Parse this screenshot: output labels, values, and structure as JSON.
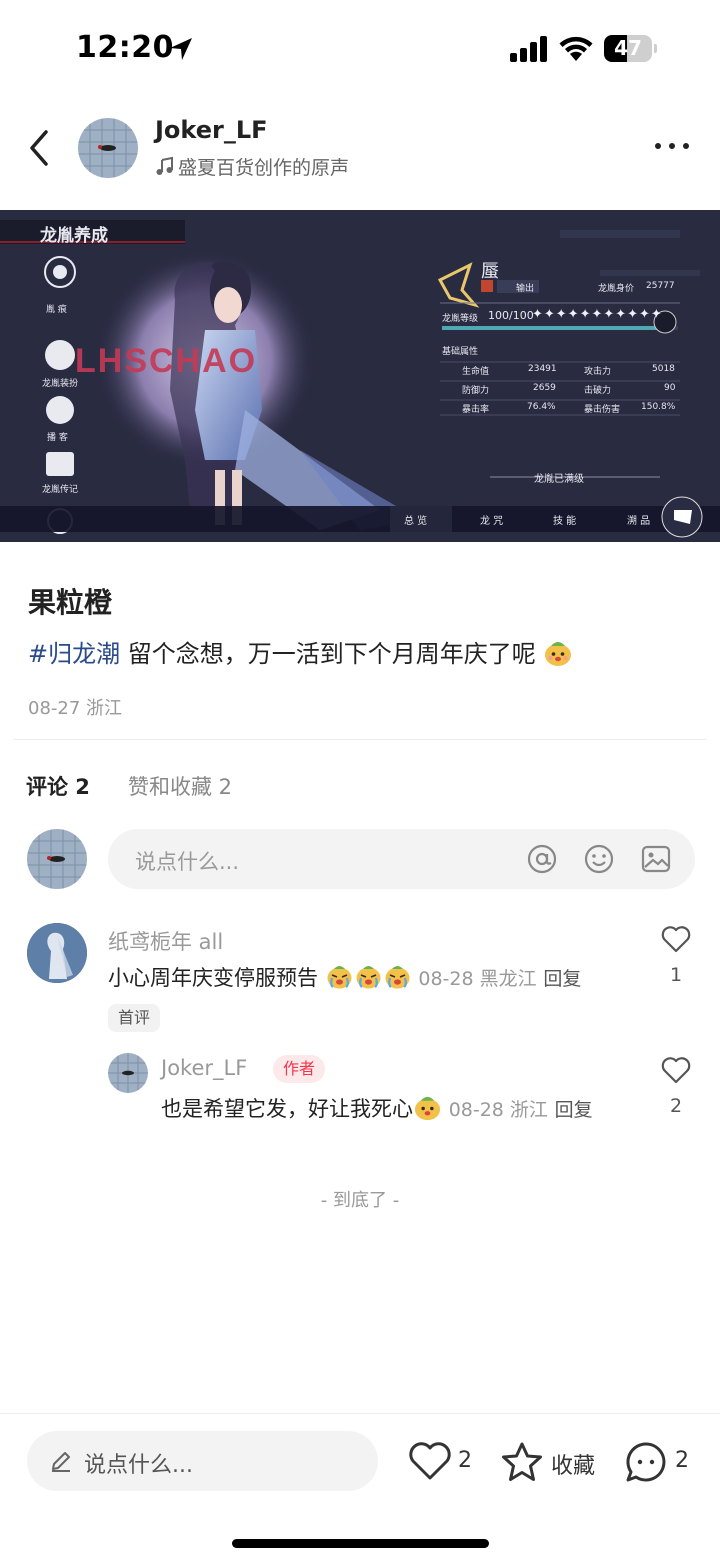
{
  "status_bar": {
    "time": "12:20",
    "battery": "47",
    "battery_level": 0.47
  },
  "header": {
    "username": "Joker_LF",
    "music": "盛夏百货创作的原声"
  },
  "post_image": {
    "menu_title": "龙胤养成",
    "side_menu": [
      "胤 痕",
      "龙胤装扮",
      "播 客",
      "龙胤传记"
    ],
    "logo_text": "LHSCHAO",
    "char_name": "蜃",
    "role": "输出",
    "worth_label": "龙胤身价",
    "worth_value": "25777",
    "level_label": "龙胤等级",
    "level_value": "100/100",
    "level_fill": 0.97,
    "attr_title": "基础属性",
    "stats": [
      {
        "label": "生命值",
        "value": "23491"
      },
      {
        "label": "攻击力",
        "value": "5018"
      },
      {
        "label": "防御力",
        "value": "2659"
      },
      {
        "label": "击破力",
        "value": "90"
      },
      {
        "label": "暴击率",
        "value": "76.4%"
      },
      {
        "label": "暴击伤害",
        "value": "150.8%"
      }
    ],
    "max_level": "龙胤已满级",
    "bottom_tabs": [
      "总 览",
      "龙 咒",
      "技 能",
      "溯 品"
    ]
  },
  "post": {
    "title": "果粒橙",
    "hashtag": "#归龙潮",
    "body": " 留个念想，万一活到下个月周年庆了呢",
    "meta": "08-27 浙江"
  },
  "tabs": {
    "comments": "评论 2",
    "likes": "赞和收藏 2"
  },
  "comment_input": {
    "placeholder": "说点什么..."
  },
  "comments": [
    {
      "name": "纸鸢栀年 all",
      "text": "小心周年庆变停服预告",
      "meta": "08-28 黑龙江",
      "reply": "回复",
      "badge": "首评",
      "likes": "1"
    },
    {
      "name": "Joker_LF",
      "badge": "作者",
      "text": "也是希望它发，好让我死心",
      "meta": "08-28 浙江",
      "reply": "回复",
      "likes": "2"
    }
  ],
  "end_text": "- 到底了 -",
  "bottom_bar": {
    "placeholder": "说点什么...",
    "like_count": "2",
    "collect_label": "收藏",
    "comment_count": "2"
  }
}
